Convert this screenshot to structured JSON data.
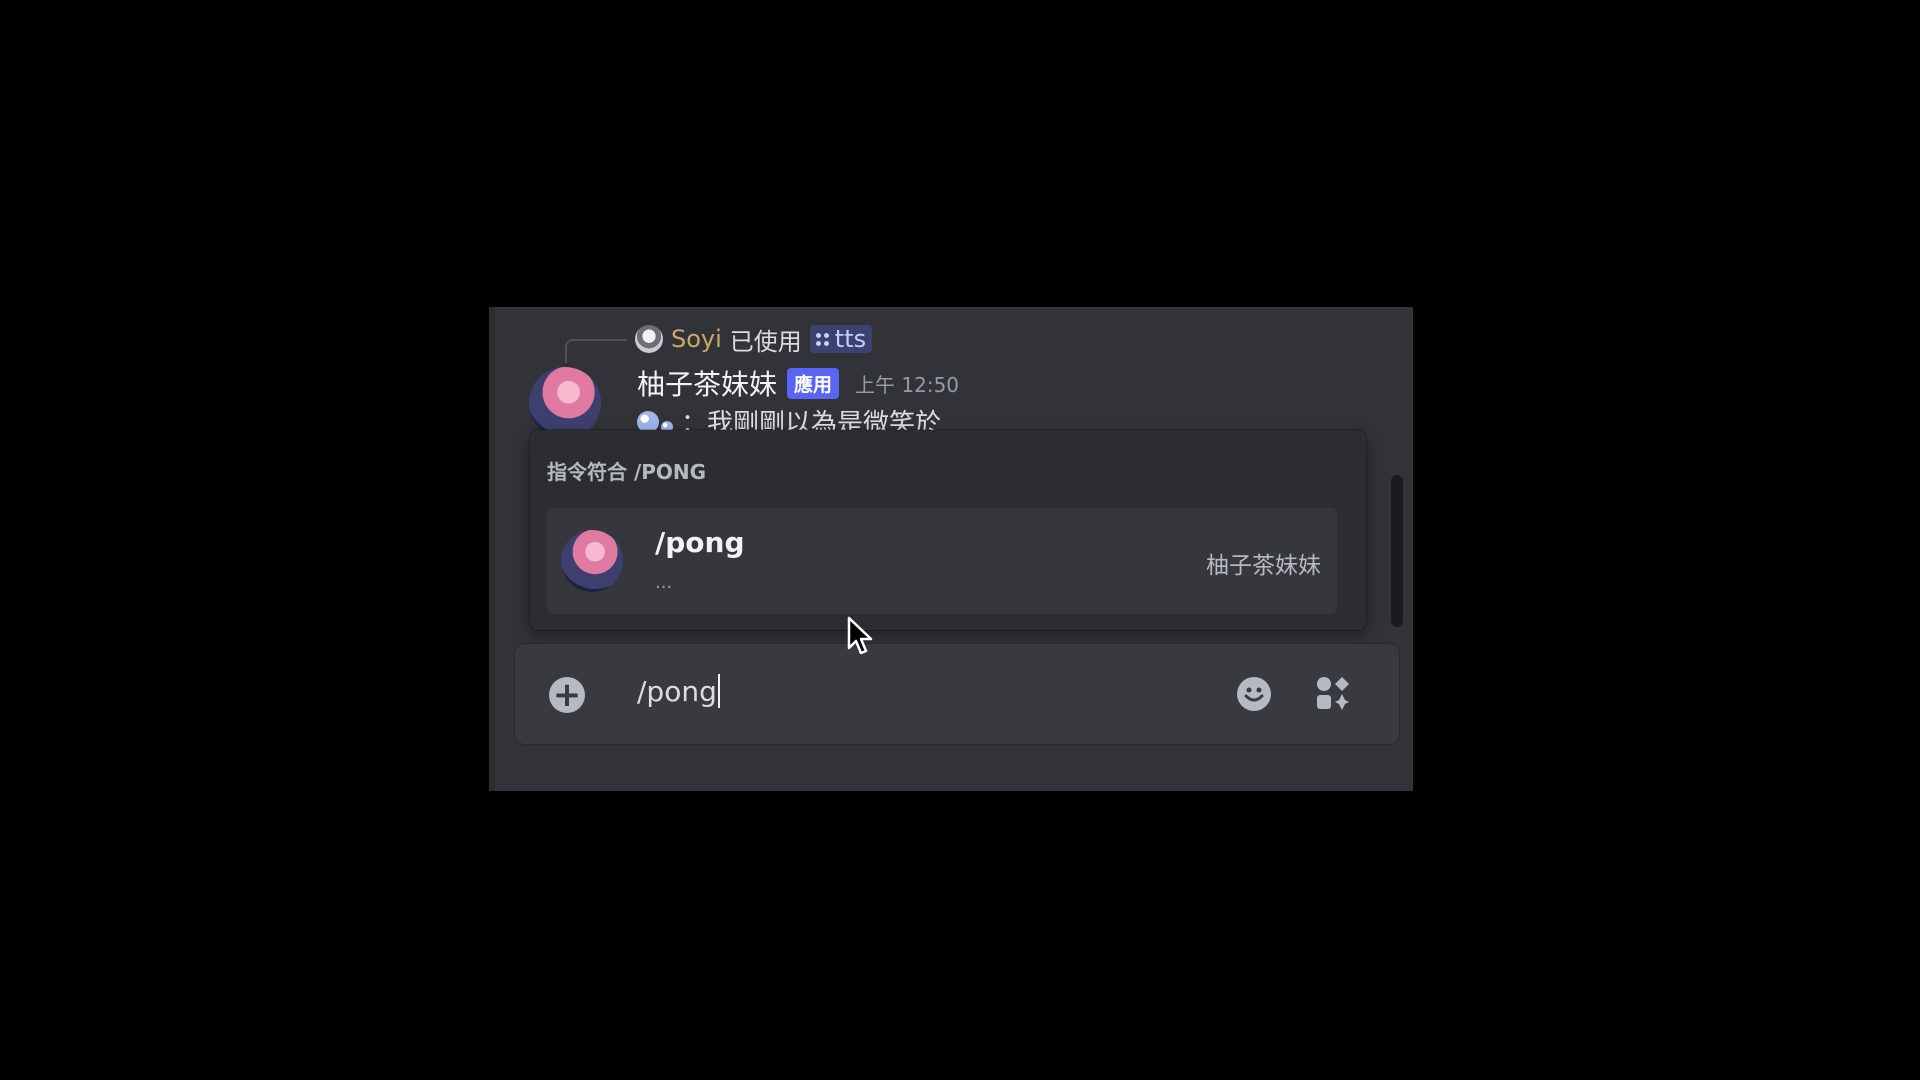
{
  "reply": {
    "user": "Soyi",
    "action": "已使用",
    "command": "tts"
  },
  "message": {
    "author": "柚子茶妹妹",
    "badge": "應用",
    "timestamp": "上午 12:50",
    "text": "：我剛剛以為是微笑於"
  },
  "autocomplete": {
    "header": "指令符合 /PONG",
    "items": [
      {
        "name": "/pong",
        "description": "...",
        "source": "柚子茶妹妹"
      }
    ]
  },
  "composer": {
    "value": "/pong"
  },
  "icons": {
    "add": "plus-circle-icon",
    "emoji": "smiley-icon",
    "apps": "apps-icon",
    "command": "slash-command-icon",
    "cursor": "mouse-pointer-icon"
  },
  "colors": {
    "background": "#313338",
    "popup": "#2b2d31",
    "badge": "#5865f2",
    "reply_user": "#c9a86a"
  }
}
